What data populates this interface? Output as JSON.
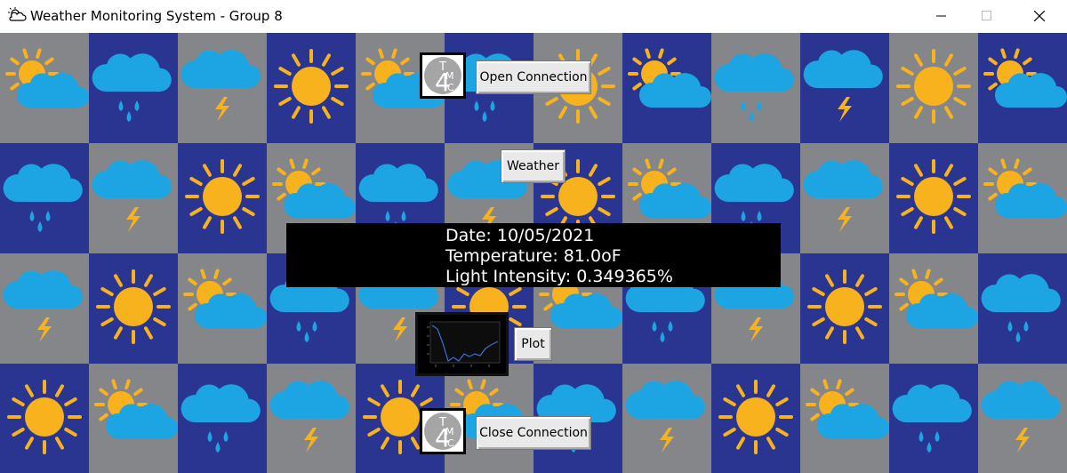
{
  "window": {
    "title": "Weather Monitoring System - Group 8",
    "icon": "cloud-sun-icon",
    "controls": [
      "minimize-icon",
      "maximize-icon",
      "close-icon"
    ]
  },
  "buttons": {
    "open_connection": "Open Connection",
    "weather": "Weather",
    "plot": "Plot",
    "close_connection": "Close Connection"
  },
  "logo": {
    "text_t": "T",
    "text_m": "M",
    "text_4": "4",
    "text_c": "C"
  },
  "readout": {
    "date": "Date: 10/05/2021",
    "temperature": "Temperature: 81.0oF",
    "light": "Light Intensity: 0.349365%"
  },
  "background": {
    "colors": {
      "blue": "#2a3591",
      "gray": "#85868a",
      "sun": "#f7b21d",
      "cloud": "#1ca5e2"
    },
    "tiles": [
      [
        "sun-cloud",
        "rain",
        "storm",
        "sun",
        "sun-cloud",
        "rain",
        "sun",
        "sun-cloud",
        "rain",
        "storm",
        "sun",
        "sun-cloud"
      ],
      [
        "rain",
        "storm",
        "sun",
        "sun-cloud",
        "rain",
        "storm",
        "sun",
        "sun-cloud",
        "rain",
        "storm",
        "sun",
        "sun-cloud"
      ],
      [
        "storm",
        "sun",
        "sun-cloud",
        "rain",
        "storm",
        "sun",
        "sun-cloud",
        "rain",
        "storm",
        "sun",
        "sun-cloud",
        "rain"
      ],
      [
        "sun",
        "sun-cloud",
        "rain",
        "storm",
        "sun",
        "sun-cloud",
        "rain",
        "storm",
        "sun",
        "sun-cloud",
        "rain",
        "storm"
      ]
    ]
  }
}
